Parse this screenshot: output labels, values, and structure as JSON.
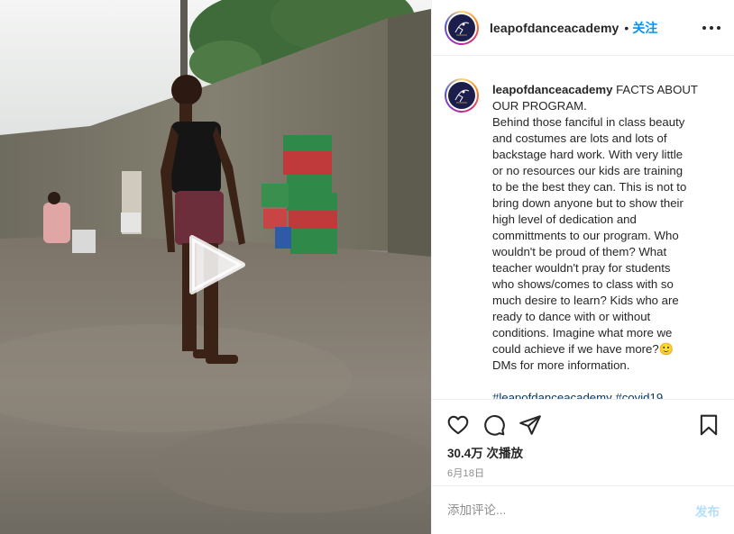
{
  "post": {
    "username": "leapofdanceacademy",
    "separator": "•",
    "follow_label": "关注",
    "caption_lines": [
      "FACTS ABOUT",
      "OUR PROGRAM.",
      "Behind those fanciful in class beauty",
      "and costumes are lots and lots of",
      "backstage hard work. With very little",
      "or no resources our kids are training",
      "to be the best they can. This is not to",
      "bring down anyone but to show their",
      "high level of dedication and",
      "committments to our program. Who",
      "wouldn't be proud of them? What",
      "teacher wouldn't pray for students",
      "who shows/comes to class with so",
      "much desire to learn? Kids who are",
      "ready to dance with or without",
      "conditions. Imagine what more we",
      "could achieve if we have more?🙂",
      "DMs for more information."
    ],
    "hashtags": "#leapofdanceacademy #covid19",
    "views": "30.4万 次播放",
    "date": "6月18日"
  },
  "comment": {
    "placeholder": "添加评论...",
    "post_label": "发布"
  },
  "icons": {
    "like": "heart-icon",
    "comment": "comment-icon",
    "share": "share-icon",
    "save": "bookmark-icon",
    "more": "more-options-icon",
    "play": "play-icon"
  },
  "colors": {
    "link_blue": "#0095f6",
    "hashtag": "#00376b",
    "muted": "#8e8e8e",
    "post_disabled": "#b2dffc"
  }
}
